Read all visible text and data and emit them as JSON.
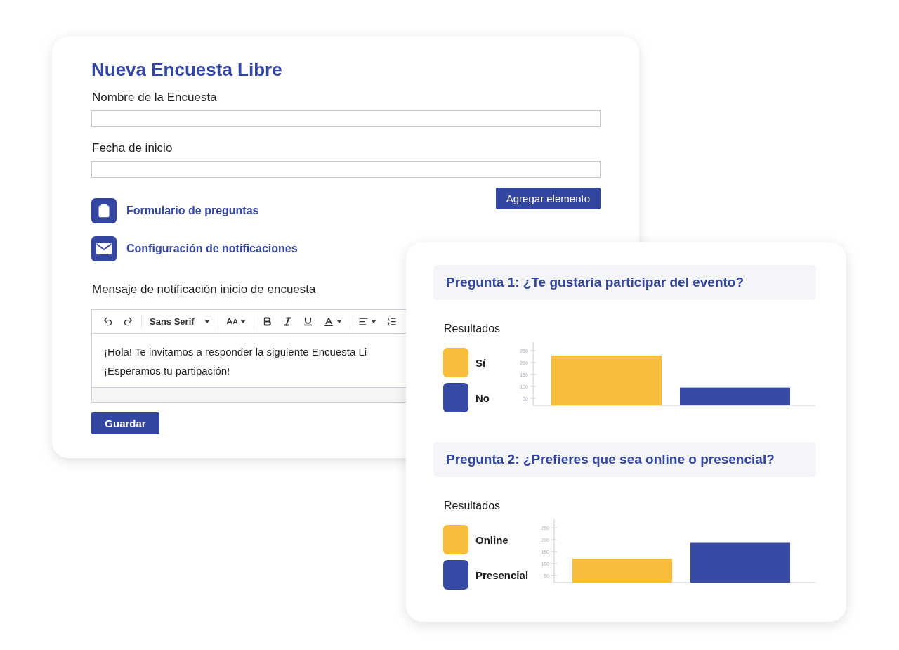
{
  "form": {
    "title": "Nueva Encuesta Libre",
    "fields": [
      {
        "label": "Nombre de la Encuesta"
      },
      {
        "label": "Fecha de inicio"
      }
    ],
    "add_button": "Agregar elemento",
    "sections": [
      {
        "kind": "clipboard",
        "label": "Formulario de preguntas"
      },
      {
        "kind": "mail",
        "label": "Configuración de notificaciones"
      }
    ],
    "editor": {
      "label": "Mensaje de notificación inicio de encuesta",
      "font": "Sans Serif",
      "lines": [
        "¡Hola! Te invitamos a responder la siguiente Encuesta Li",
        "¡Esperamos tu partipación!"
      ]
    },
    "save_button": "Guardar"
  },
  "results": [
    {
      "question": "Pregunta 1: ¿Te gustaría participar del evento?",
      "results_label": "Resultados",
      "chart_data": {
        "type": "bar",
        "ylim": [
          20,
          280
        ],
        "yticks": [
          50,
          100,
          150,
          200,
          250
        ],
        "series": [
          {
            "name": "Sí",
            "color": "#f9bd3c",
            "values": [
              230
            ]
          },
          {
            "name": "No",
            "color": "#364ba4",
            "values": [
              95
            ]
          }
        ]
      }
    },
    {
      "question": "Pregunta 2: ¿Prefieres que sea online o presencial?",
      "results_label": "Resultados",
      "chart_data": {
        "type": "bar",
        "ylim": [
          20,
          280
        ],
        "yticks": [
          50,
          100,
          150,
          200,
          250
        ],
        "series": [
          {
            "name": "Online",
            "color": "#f9bd3c",
            "values": [
              120
            ]
          },
          {
            "name": "Presencial",
            "color": "#364ba4",
            "values": [
              187
            ]
          }
        ]
      }
    }
  ]
}
